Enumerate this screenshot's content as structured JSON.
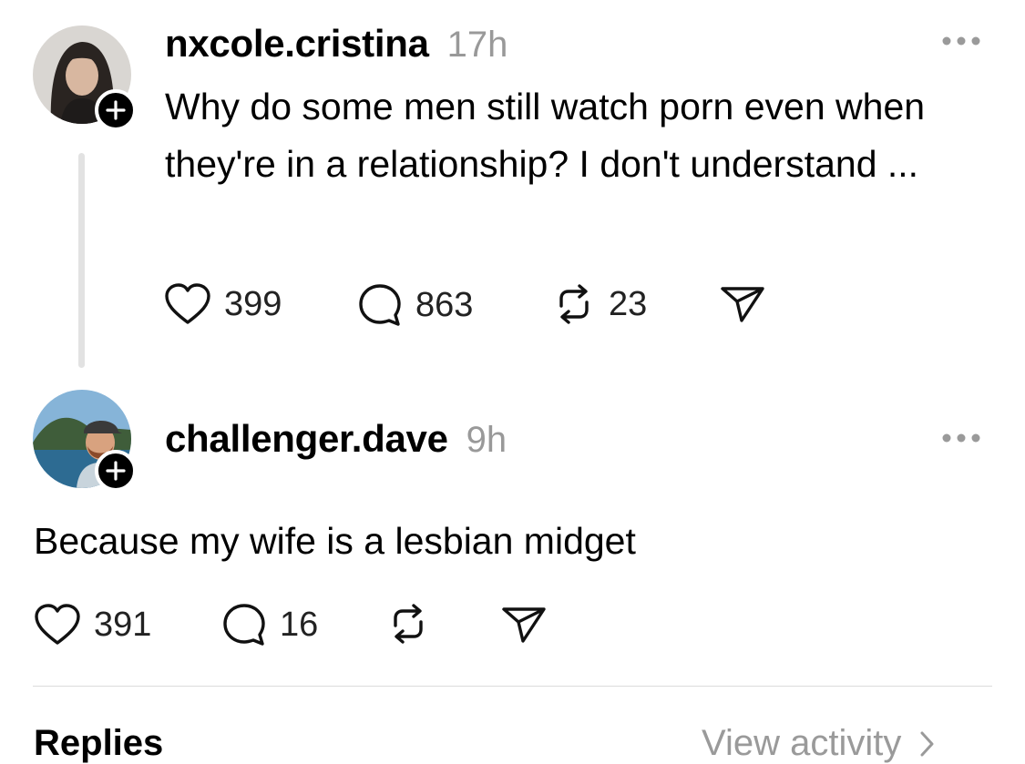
{
  "thread": {
    "post": {
      "username": "nxcole.cristina",
      "time": "17h",
      "text": "Why do some men still watch porn even when they're in a relationship? I don't understand ...",
      "likes": "399",
      "comments": "863",
      "reposts": "23"
    },
    "reply": {
      "username": "challenger.dave",
      "time": "9h",
      "text": "Because my wife is a lesbian midget",
      "likes": "391",
      "comments": "16"
    }
  },
  "footer": {
    "replies_label": "Replies",
    "view_activity_label": "View activity"
  },
  "icons": {
    "like": "heart-icon",
    "comment": "comment-bubble-icon",
    "repost": "repost-icon",
    "share": "send-icon",
    "more": "more-dots-icon",
    "follow": "plus-icon"
  }
}
